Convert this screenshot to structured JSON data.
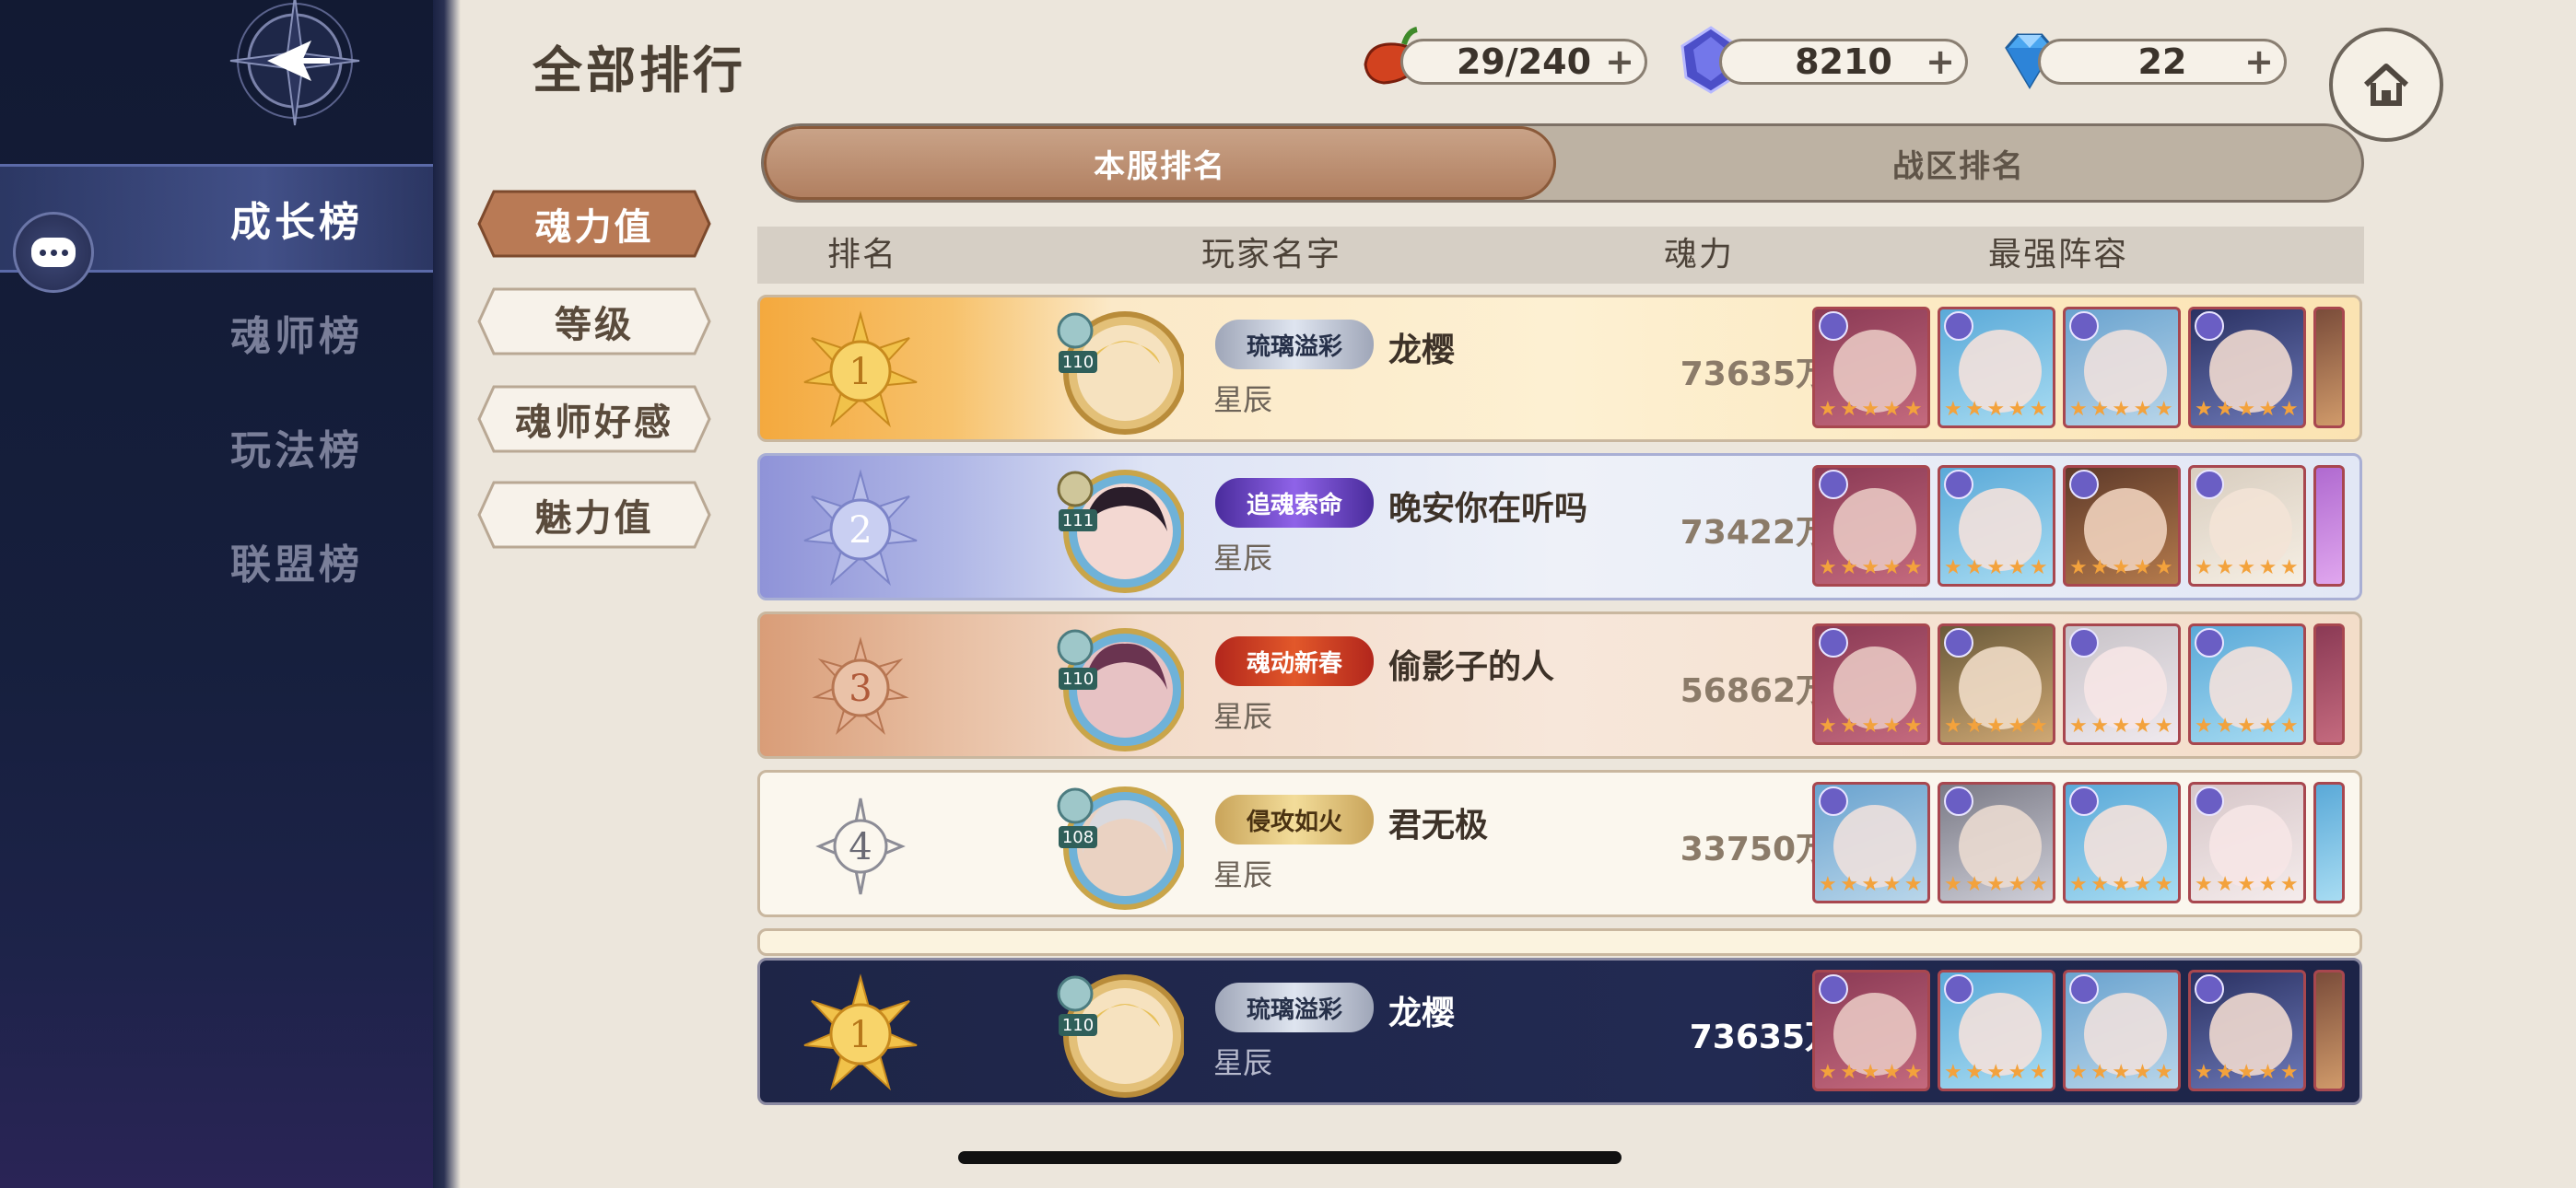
{
  "sidebar": {
    "items": [
      {
        "label": "成长榜",
        "active": true
      },
      {
        "label": "魂师榜",
        "active": false
      },
      {
        "label": "玩法榜",
        "active": false
      },
      {
        "label": "联盟榜",
        "active": false
      }
    ]
  },
  "header": {
    "title": "全部排行",
    "resources": [
      {
        "icon": "chili-stamina-icon",
        "value": "29/240"
      },
      {
        "icon": "purple-crystal-icon",
        "value": "8210"
      },
      {
        "icon": "blue-diamond-icon",
        "value": "22"
      }
    ]
  },
  "categories": [
    {
      "label": "魂力值",
      "active": true
    },
    {
      "label": "等级",
      "active": false
    },
    {
      "label": "魂师好感",
      "active": false
    },
    {
      "label": "魅力值",
      "active": false
    }
  ],
  "tabs": [
    {
      "label": "本服排名",
      "active": true
    },
    {
      "label": "战区排名",
      "active": false
    }
  ],
  "table": {
    "columns": [
      "排名",
      "玩家名字",
      "魂力",
      "最强阵容"
    ],
    "rows": [
      {
        "rank": "1",
        "level": "110",
        "title": "琉璃溢彩",
        "name": "龙樱",
        "server": "星辰",
        "power": "73635万"
      },
      {
        "rank": "2",
        "level": "111",
        "title": "追魂索命",
        "name": "晚安你在听吗",
        "server": "星辰",
        "power": "73422万"
      },
      {
        "rank": "3",
        "level": "110",
        "title": "魂动新春",
        "name": "偷影子的人",
        "server": "星辰",
        "power": "56862万"
      },
      {
        "rank": "4",
        "level": "108",
        "title": "侵攻如火",
        "name": "君无极",
        "server": "星辰",
        "power": "33750万"
      }
    ],
    "mine": {
      "rank": "1",
      "level": "110",
      "title": "琉璃溢彩",
      "name": "龙樱",
      "server": "星辰",
      "power": "73635万"
    }
  },
  "colors": {
    "accent": "#b07e5f",
    "gold": "#f4a93e",
    "silver": "#8f93d8",
    "bronze": "#d99d78",
    "sidebar": "#161f3d"
  }
}
